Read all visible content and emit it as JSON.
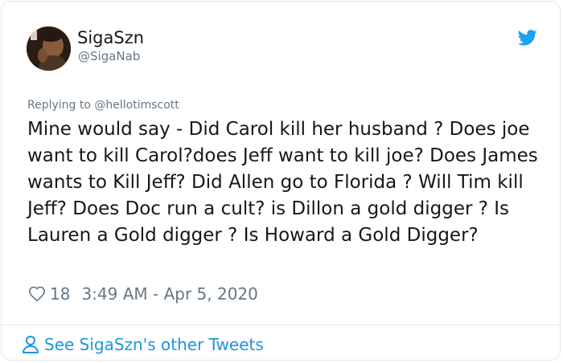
{
  "user": {
    "display_name": "SigaSzn",
    "handle": "@SigaNab"
  },
  "reply": {
    "prefix": "Replying to",
    "mention": "@hellotimscott"
  },
  "tweet": {
    "text": "Mine would say - Did Carol kill her husband ? Does joe want to kill Carol?does Jeff want to kill joe? Does James wants to Kill Jeff? Did Allen go to Florida ? Will Tim kill Jeff? Does Doc run a cult? is Dillon a gold digger ? Is Lauren a Gold digger ? Is Howard a Gold Digger?",
    "likes": "18",
    "timestamp": "3:49 AM - Apr 5, 2020"
  },
  "footer": {
    "other_tweets_label": "See SigaSzn's other Tweets"
  },
  "icons": {
    "brand": "twitter-bird-icon",
    "like": "heart-icon",
    "profile": "person-icon"
  },
  "colors": {
    "twitter_blue": "#1da1f2",
    "link_blue": "#1b95e0",
    "secondary_text": "#657786",
    "border": "#e1e8ed"
  }
}
